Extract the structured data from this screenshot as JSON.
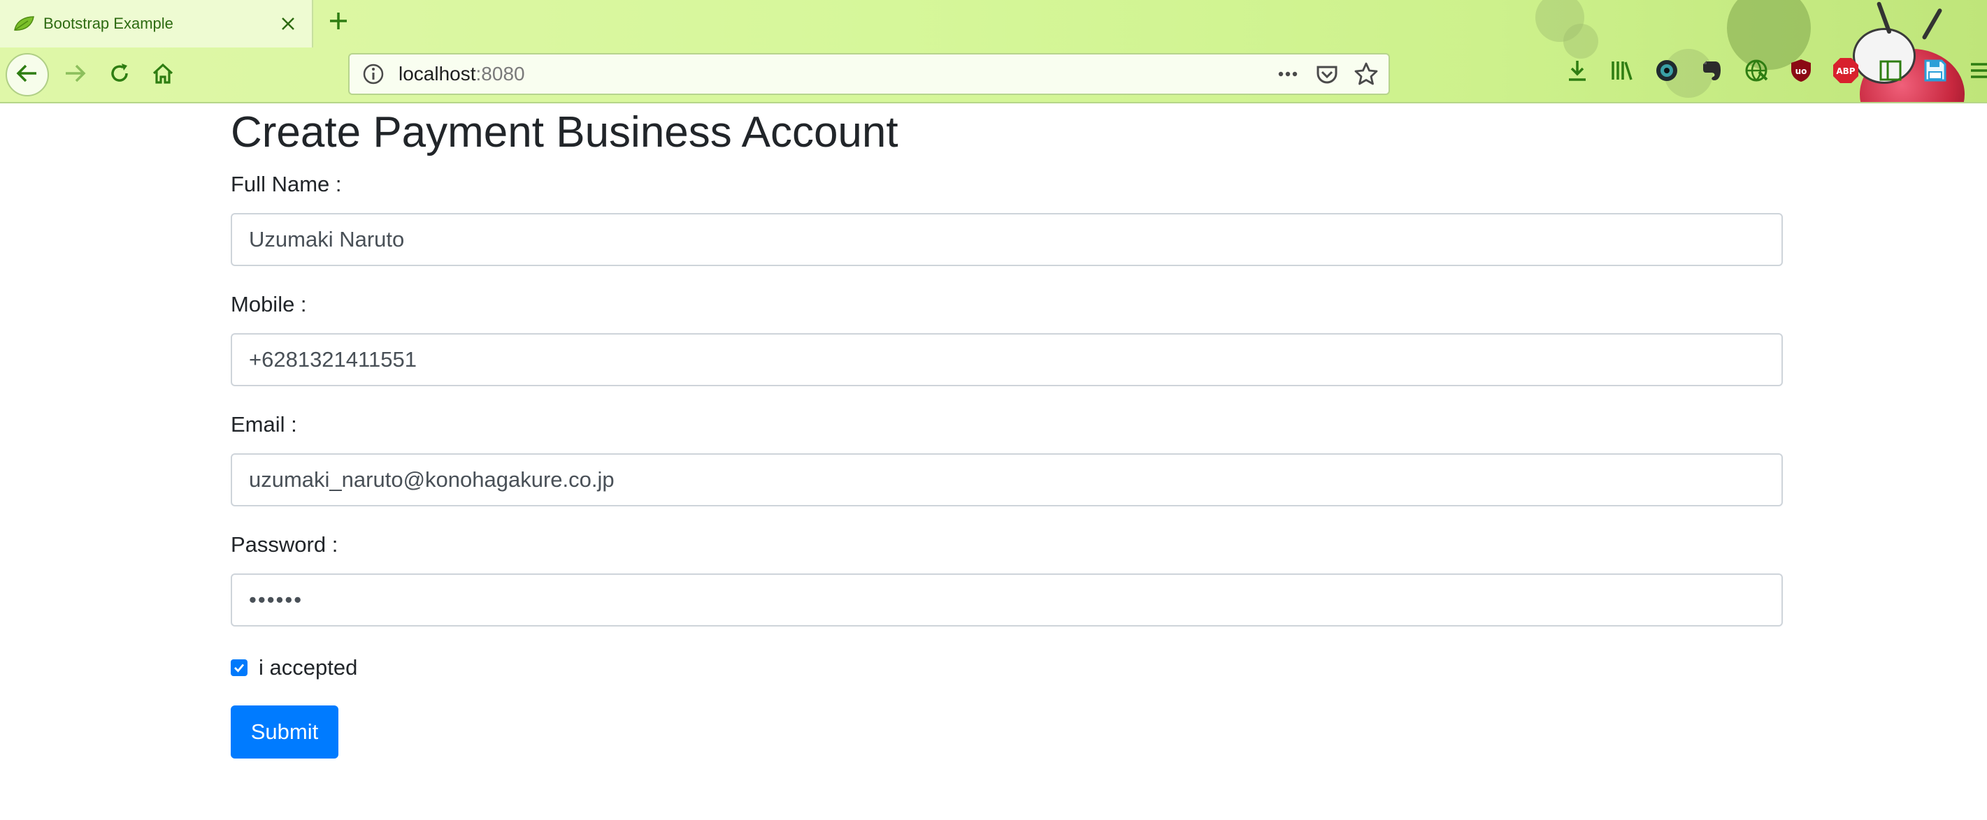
{
  "browser": {
    "tab": {
      "title": "Bootstrap Example"
    },
    "url": {
      "host": "localhost",
      "port": ":8080"
    },
    "icons": {
      "tab_favicon": "leaf-icon",
      "tab_close": "close-icon",
      "new_tab": "plus-icon",
      "back": "arrow-left-icon",
      "forward": "arrow-right-icon",
      "reload": "reload-icon",
      "home": "home-icon",
      "site_info": "info-icon",
      "page_actions": "ellipsis-icon",
      "pocket": "pocket-icon",
      "bookmark": "star-icon",
      "toolbar": [
        "download-icon",
        "library-icon",
        "extension-icon",
        "evernote-icon",
        "globe-icon",
        "ublock-icon",
        "adblock-icon",
        "sidebar-icon",
        "save-icon",
        "menu-icon"
      ]
    },
    "toolbar_badges": {
      "ublock": "uo",
      "adblock": "ABP"
    }
  },
  "page": {
    "title": "Create Payment Business Account",
    "form": {
      "full_name": {
        "label": "Full Name :",
        "value": "Uzumaki Naruto"
      },
      "mobile": {
        "label": "Mobile :",
        "value": "+6281321411551"
      },
      "email": {
        "label": "Email :",
        "value": "uzumaki_naruto@konohagakure.co.jp"
      },
      "password": {
        "label": "Password :",
        "value": "••••••"
      },
      "accept": {
        "label": "i accepted",
        "checked": true
      },
      "submit_label": "Submit"
    }
  },
  "colors": {
    "primary": "#007bff",
    "chrome_green": "#d6f79a",
    "icon_green": "#2e7d12",
    "text": "#212529"
  }
}
